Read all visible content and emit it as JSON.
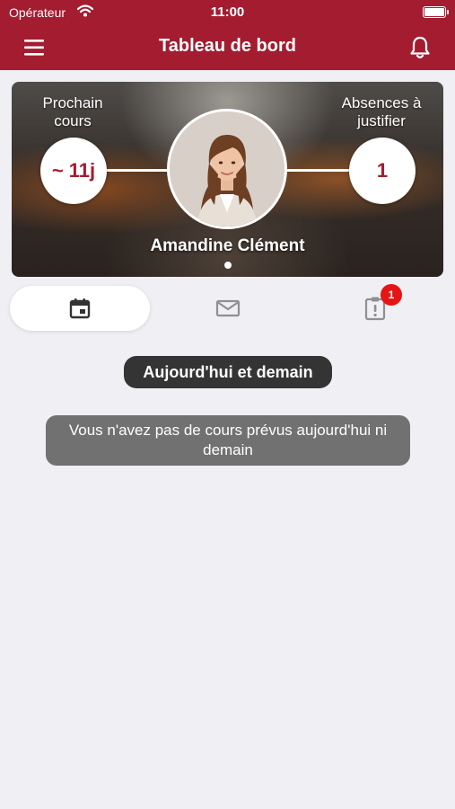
{
  "status_bar": {
    "carrier": "Opérateur",
    "time": "11:00"
  },
  "header": {
    "title": "Tableau de bord",
    "menu_icon": "hamburger-menu-icon",
    "notifications_icon": "bell-icon"
  },
  "hero": {
    "next_course_label": "Prochain cours",
    "next_course_value": "~ 11j",
    "absences_label": "Absences à justifier",
    "absences_value": "1",
    "student_name": "Amandine Clément"
  },
  "tabs": [
    {
      "icon": "calendar-icon",
      "active": true
    },
    {
      "icon": "envelope-icon",
      "active": false
    },
    {
      "icon": "alert-clipboard-icon",
      "active": false,
      "badge": "1"
    }
  ],
  "schedule": {
    "section_title": "Aujourd'hui et demain",
    "empty_message": "Vous n'avez pas de cours prévus aujourd'hui ni demain"
  },
  "colors": {
    "brand": "#a31c30",
    "badge": "#e41515",
    "background": "#efeff4"
  }
}
